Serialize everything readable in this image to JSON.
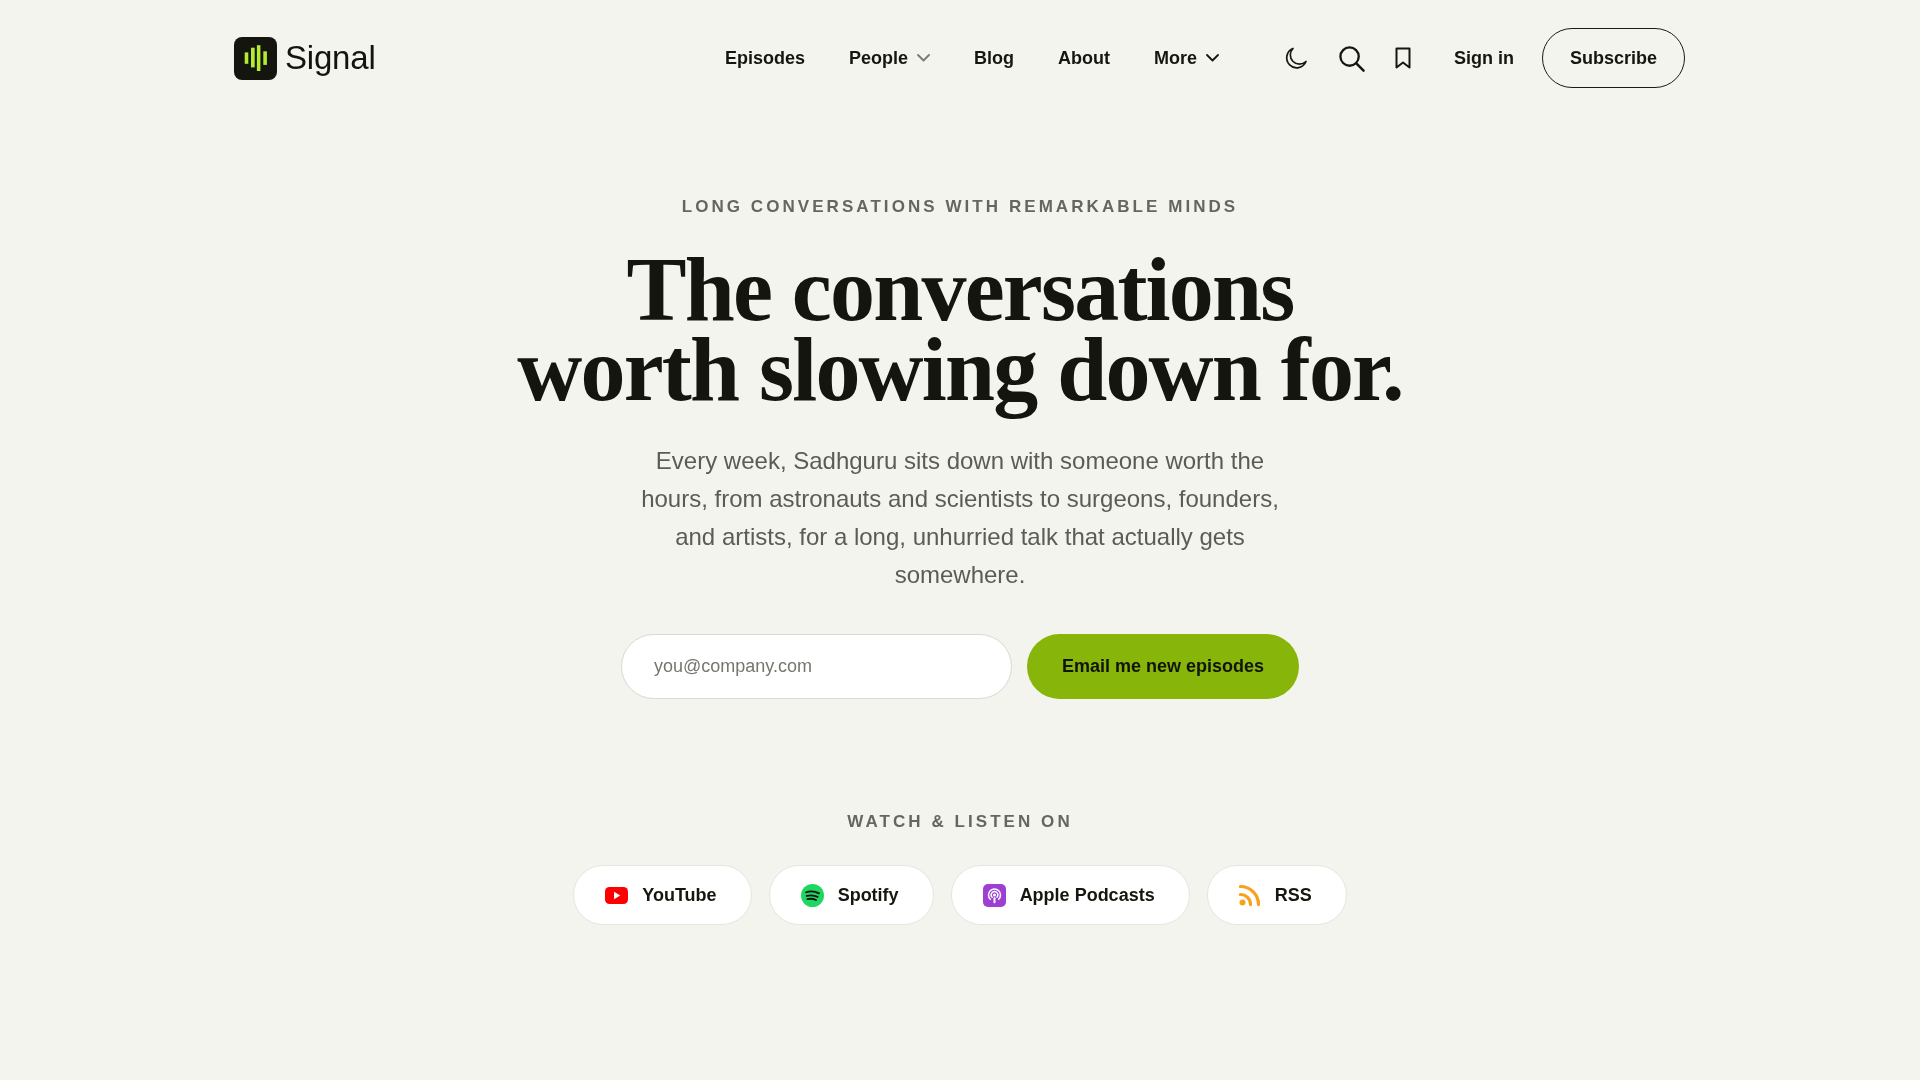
{
  "header": {
    "logo": {
      "name": "Signal"
    },
    "nav": [
      {
        "label": "Episodes",
        "dropdown": false
      },
      {
        "label": "People",
        "dropdown": true
      },
      {
        "label": "Blog",
        "dropdown": false
      },
      {
        "label": "About",
        "dropdown": false
      },
      {
        "label": "More",
        "dropdown": true
      }
    ],
    "sign_in": "Sign in",
    "subscribe": "Subscribe"
  },
  "hero": {
    "eyebrow": "LONG CONVERSATIONS WITH REMARKABLE MINDS",
    "title_lines": [
      "The conversations",
      "worth slowing down for."
    ],
    "description": "Every week, Sadhguru sits down with someone worth the hours, from astronauts and scientists to surgeons, founders, and artists, for a long, unhurried talk that actually gets somewhere.",
    "signup": {
      "placeholder": "you@company.com",
      "button": "Email me new episodes"
    }
  },
  "platforms": {
    "heading": "WATCH & LISTEN ON",
    "items": [
      {
        "kind": "youtube",
        "label": "YouTube"
      },
      {
        "kind": "spotify",
        "label": "Spotify"
      },
      {
        "kind": "apple_podcasts",
        "label": "Apple Podcasts"
      },
      {
        "kind": "rss",
        "label": "RSS"
      }
    ]
  }
}
